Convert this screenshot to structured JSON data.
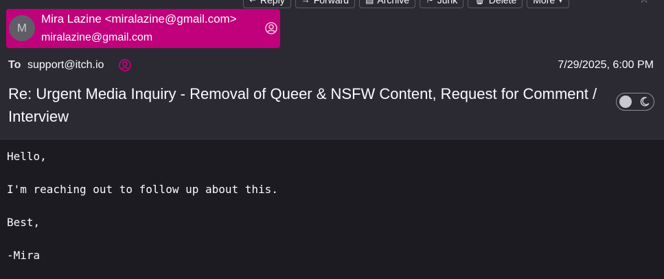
{
  "toolbar": {
    "buttons": [
      {
        "label": "Reply",
        "icon": "reply-icon"
      },
      {
        "label": "Forward",
        "icon": "forward-icon"
      },
      {
        "label": "Archive",
        "icon": "archive-icon"
      },
      {
        "label": "Junk",
        "icon": "junk-icon"
      },
      {
        "label": "Delete",
        "icon": "delete-icon"
      },
      {
        "label": "More",
        "icon": "chevron-down-icon"
      }
    ]
  },
  "header": {
    "from": {
      "avatar_initial": "M",
      "display": "Mira Lazine <miralazine@gmail.com>",
      "email": "miralazine@gmail.com",
      "pill_color": "#c1007b"
    },
    "to_label": "To",
    "to_address": "support@itch.io",
    "date": "7/29/2025, 6:00 PM",
    "subject": "Re: Urgent Media Inquiry - Removal of Queer & NSFW Content, Request for Comment / Interview"
  },
  "body": {
    "lines": [
      "Hello,",
      "I'm reaching out to follow up about this.",
      "Best,",
      "-Mira"
    ]
  }
}
